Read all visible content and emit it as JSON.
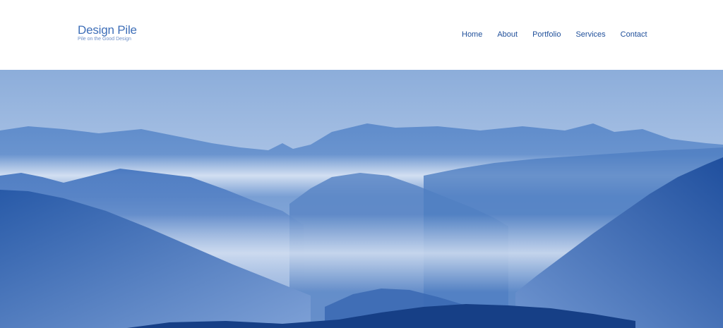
{
  "brand": {
    "title": "Design Pile",
    "tagline": "Pile on the Good Design"
  },
  "nav": {
    "items": [
      {
        "label": "Home"
      },
      {
        "label": "About"
      },
      {
        "label": "Portfolio"
      },
      {
        "label": "Services"
      },
      {
        "label": "Contact"
      }
    ]
  },
  "hero": {
    "image": "blue misty mountain range",
    "colors": {
      "sky_top": "#8fb0db",
      "sky_bottom": "#c9d9ef",
      "haze": "#d7e3f4",
      "far_ridge": "#6f97d0",
      "mid_ridge": "#4c7bc2",
      "near_ridge": "#2f60ad",
      "foreground": "#163f86"
    }
  }
}
